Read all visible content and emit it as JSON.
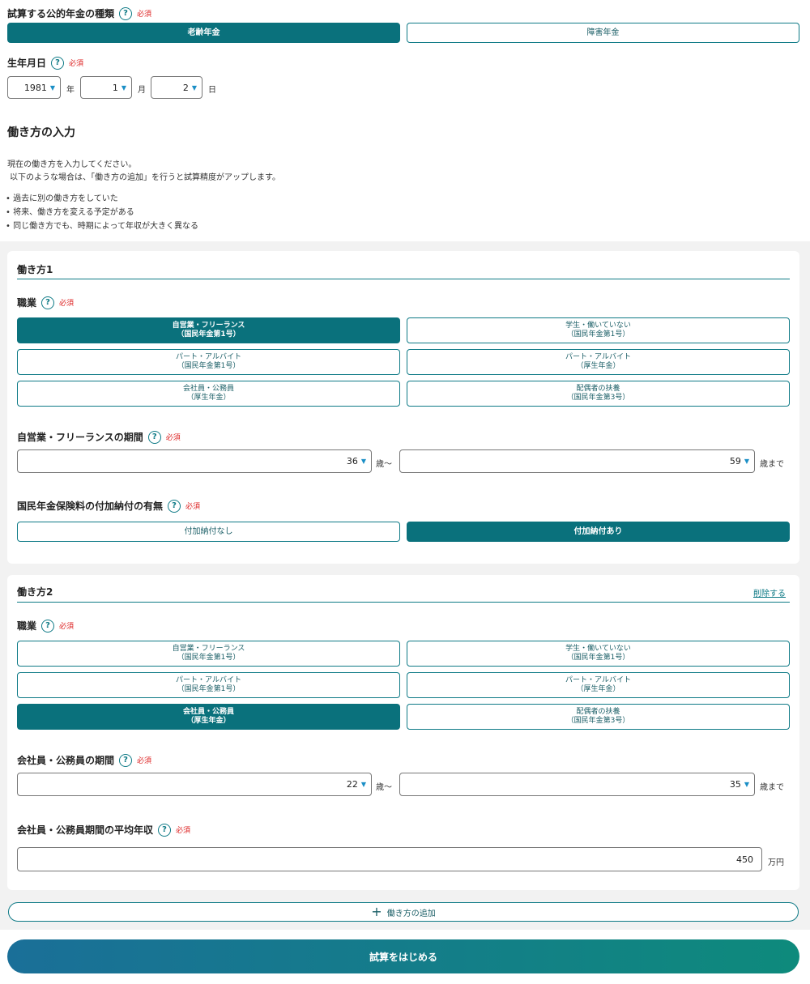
{
  "pension_type": {
    "label": "試算する公的年金の種類",
    "required": "必須",
    "options": [
      "老齢年金",
      "障害年金"
    ],
    "selected": "老齢年金"
  },
  "birthdate": {
    "label": "生年月日",
    "required": "必須",
    "year": "1981",
    "year_unit": "年",
    "month": "1",
    "month_unit": "月",
    "day": "2",
    "day_unit": "日"
  },
  "work_section": {
    "heading": "働き方の入力",
    "intro1": "現在の働き方を入力してください。",
    "intro2": "以下のような場合は、「働き方の追加」を行うと試算精度がアップします。",
    "bullets": [
      "過去に別の働き方をしていた",
      "将来、働き方を変える予定がある",
      "同じ働き方でも、時期によって年収が大きく異なる"
    ]
  },
  "work1": {
    "title": "働き方1",
    "job_label": "職業",
    "required": "必須",
    "jobs": [
      {
        "line1": "自営業・フリーランス",
        "line2": "（国民年金第1号）"
      },
      {
        "line1": "学生・働いていない",
        "line2": "（国民年金第1号）"
      },
      {
        "line1": "パート・アルバイト",
        "line2": "（国民年金第1号）"
      },
      {
        "line1": "パート・アルバイト",
        "line2": "（厚生年金）"
      },
      {
        "line1": "会社員・公務員",
        "line2": "（厚生年金）"
      },
      {
        "line1": "配偶者の扶養",
        "line2": "（国民年金第3号）"
      }
    ],
    "selected_job": "自営業・フリーランス",
    "period_label": "自営業・フリーランスの期間",
    "period_from": "36",
    "from_unit": "歳～",
    "period_to": "59",
    "to_unit": "歳まで",
    "extra_label": "国民年金保険料の付加納付の有無",
    "extra_options": [
      "付加納付なし",
      "付加納付あり"
    ],
    "extra_selected": "付加納付あり"
  },
  "work2": {
    "title": "働き方2",
    "delete_link": "削除する",
    "job_label": "職業",
    "required": "必須",
    "jobs": [
      {
        "line1": "自営業・フリーランス",
        "line2": "（国民年金第1号）"
      },
      {
        "line1": "学生・働いていない",
        "line2": "（国民年金第1号）"
      },
      {
        "line1": "パート・アルバイト",
        "line2": "（国民年金第1号）"
      },
      {
        "line1": "パート・アルバイト",
        "line2": "（厚生年金）"
      },
      {
        "line1": "会社員・公務員",
        "line2": "（厚生年金）"
      },
      {
        "line1": "配偶者の扶養",
        "line2": "（国民年金第3号）"
      }
    ],
    "selected_job": "会社員・公務員",
    "period_label": "会社員・公務員の期間",
    "period_from": "22",
    "from_unit": "歳～",
    "period_to": "35",
    "to_unit": "歳まで",
    "income_label": "会社員・公務員期間の平均年収",
    "income_value": "450",
    "income_unit": "万円"
  },
  "add_work_label": "働き方の追加",
  "start_label": "試算をはじめる",
  "colors": {
    "accent": "#0a717c",
    "required": "#dd2222",
    "gradient_start": "#1a6f98",
    "gradient_end": "#0e8a7c"
  }
}
